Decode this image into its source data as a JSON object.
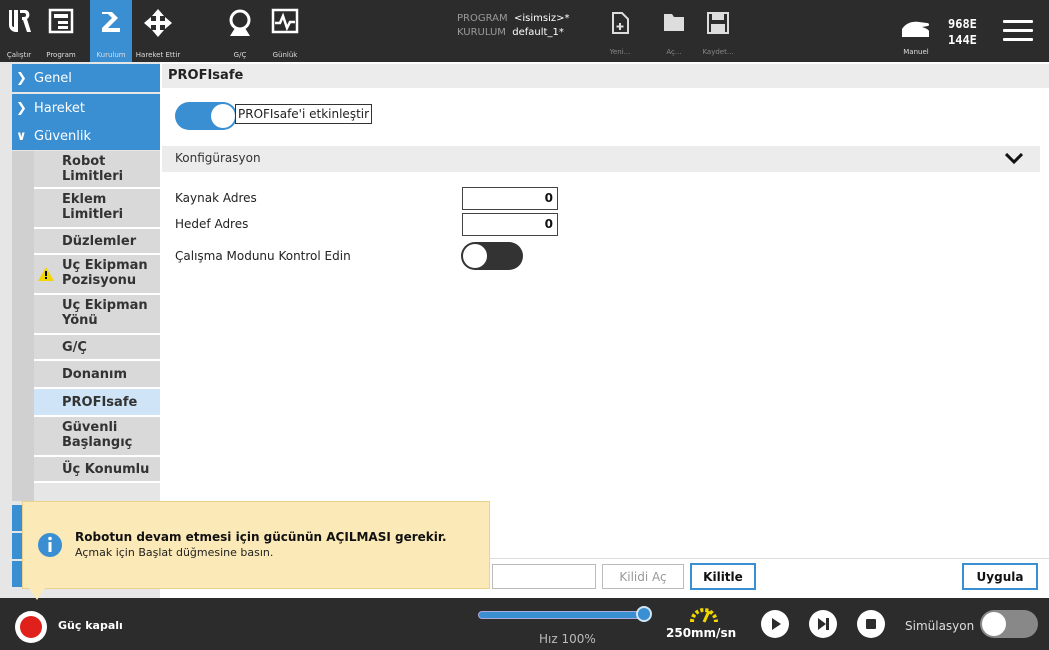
{
  "topbar": {
    "nav": [
      {
        "label": "Çalıştır",
        "icon": "ur-logo-icon"
      },
      {
        "label": "Program",
        "icon": "program-icon"
      },
      {
        "label": "Kurulum",
        "icon": "installation-icon"
      },
      {
        "label": "Hareket Ettir",
        "icon": "move-icon"
      },
      {
        "label": "G/Ç",
        "icon": "io-icon"
      },
      {
        "label": "Günlük",
        "icon": "log-icon"
      }
    ],
    "program_label": "PROGRAM",
    "program_value": "<isimsiz>*",
    "installation_label": "KURULUM",
    "installation_value": "default_1*",
    "file_buttons": [
      {
        "label": "Yeni...",
        "icon": "new-file-icon"
      },
      {
        "label": "Aç...",
        "icon": "open-folder-icon"
      },
      {
        "label": "Kaydet...",
        "icon": "save-icon"
      }
    ],
    "mode_label": "Manuel",
    "counter_top": "968E",
    "counter_bottom": "144E"
  },
  "sidebar": {
    "sections": [
      "Genel",
      "Hareket",
      "Güvenlik"
    ],
    "items": [
      {
        "label": "Robot Limitleri",
        "warn": false
      },
      {
        "label": "Eklem Limitleri",
        "warn": false
      },
      {
        "label": "Düzlemler",
        "warn": false
      },
      {
        "label": "Uç Ekipman Pozisyonu",
        "warn": true
      },
      {
        "label": "Uç Ekipman Yönü",
        "warn": false
      },
      {
        "label": "G/Ç",
        "warn": false
      },
      {
        "label": "Donanım",
        "warn": false
      },
      {
        "label": "PROFIsafe",
        "warn": false,
        "active": true
      },
      {
        "label": "Güvenli Başlangıç",
        "warn": false
      },
      {
        "label": "Üç Konumlu",
        "warn": false
      }
    ]
  },
  "main": {
    "title": "PROFIsafe",
    "enable_label": "PROFIsafe'i etkinleştir",
    "enable_state": true,
    "config_header": "Konfigürasyon",
    "fields": [
      {
        "label": "Kaynak Adres",
        "value": "0"
      },
      {
        "label": "Hedef Adres",
        "value": "0"
      }
    ],
    "mode_control_label": "Çalışma Modunu Kontrol Edin",
    "mode_control_state": false,
    "unlock_label": "Kilidi Aç",
    "lock_label": "Kilitle",
    "apply_label": "Uygula"
  },
  "toast": {
    "title": "Robotun devam etmesi için gücünün AÇILMASI gerekir.",
    "message": "Açmak için Başlat düğmesine basın."
  },
  "footer": {
    "power_label": "Güç kapalı",
    "speed_label": "Hız 100%",
    "speed_fraction": 1.0,
    "tcp_speed": "250mm/sn",
    "simulation_label": "Simülasyon",
    "simulation_state": false
  },
  "colors": {
    "accent": "#3a8fd3",
    "bar": "#2c2c2c",
    "power": "#e0201b",
    "toast": "#fbe9b7",
    "warn": "#f2d600"
  }
}
